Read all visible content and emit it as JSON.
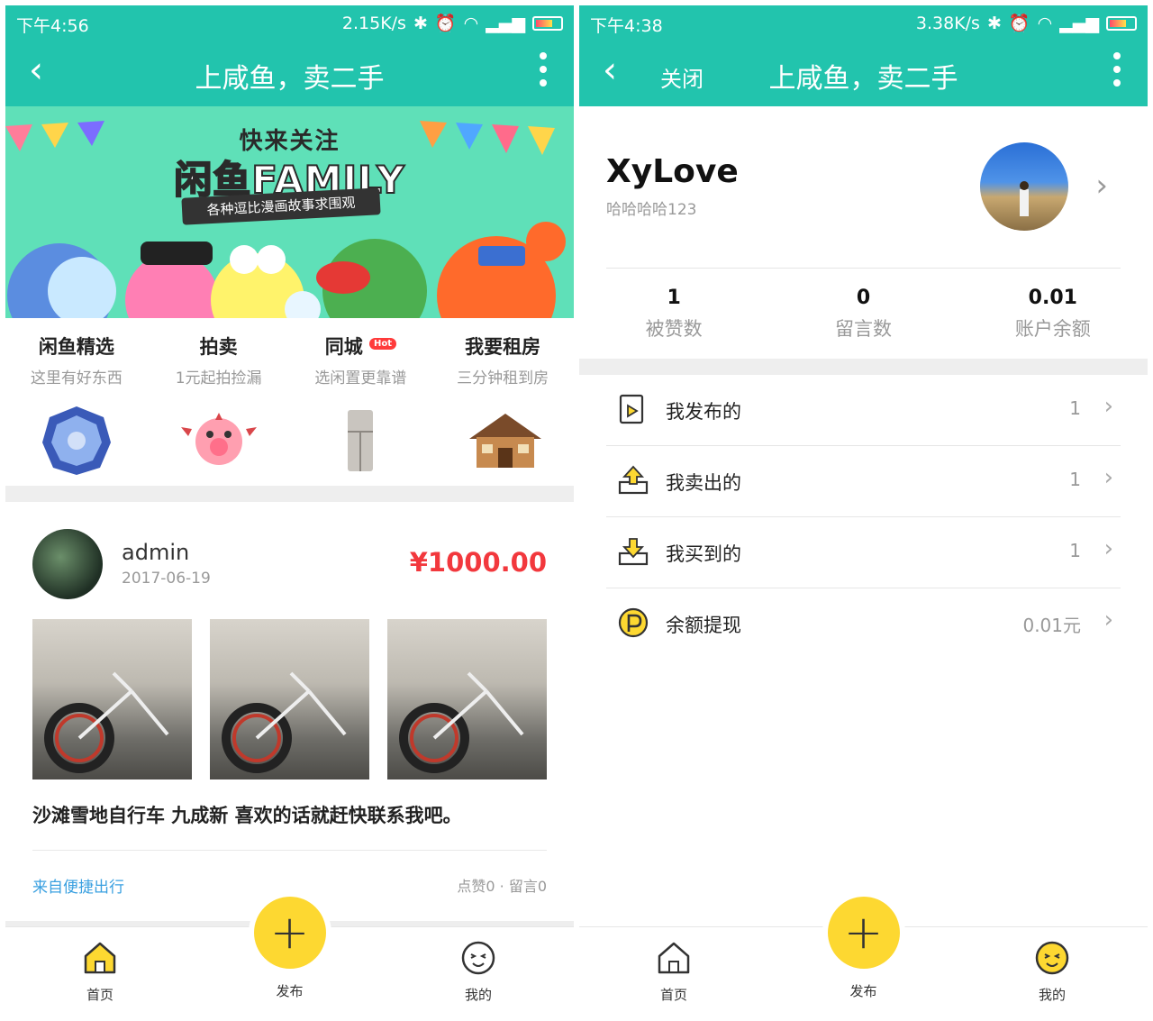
{
  "left": {
    "status": {
      "time": "下午4:56",
      "speed": "2.15K/s"
    },
    "nav": {
      "back": "‹",
      "title": "上咸鱼，卖二手"
    },
    "banner": {
      "line1": "快来关注",
      "line2": "闲鱼FAMILY",
      "line3": "各种逗比漫画故事求围观"
    },
    "categories": [
      {
        "name": "闲鱼精选",
        "sub": "这里有好东西",
        "icon": "umbrella-icon"
      },
      {
        "name": "拍卖",
        "sub": "1元起拍捡漏",
        "icon": "pig-icon"
      },
      {
        "name": "同城",
        "badge": "Hot",
        "sub": "选闲置更靠谱",
        "icon": "fridge-icon"
      },
      {
        "name": "我要租房",
        "sub": "三分钟租到房",
        "icon": "house-icon"
      }
    ],
    "post": {
      "user": "admin",
      "date": "2017-06-19",
      "price": "¥1000.00",
      "description": "沙滩雪地自行车 九成新 喜欢的话就赶快联系我吧。",
      "from": "来自便捷出行",
      "stats": "点赞0 · 留言0"
    },
    "tabbar": {
      "home": "首页",
      "publish": "发布",
      "mine": "我的"
    }
  },
  "right": {
    "status": {
      "time": "下午4:38",
      "speed": "3.38K/s"
    },
    "nav": {
      "back": "‹",
      "close": "关闭",
      "title": "上咸鱼，卖二手"
    },
    "profile": {
      "nickname": "XyLove",
      "account": "哈哈哈哈123"
    },
    "counters": [
      {
        "value": "1",
        "label": "被赞数"
      },
      {
        "value": "0",
        "label": "留言数"
      },
      {
        "value": "0.01",
        "label": "账户余额"
      }
    ],
    "menu": [
      {
        "label": "我发布的",
        "value": "1",
        "icon": "published-icon"
      },
      {
        "label": "我卖出的",
        "value": "1",
        "icon": "sold-icon"
      },
      {
        "label": "我买到的",
        "value": "1",
        "icon": "bought-icon"
      },
      {
        "label": "余额提现",
        "value": "0.01元",
        "icon": "withdraw-icon"
      }
    ],
    "tabbar": {
      "home": "首页",
      "publish": "发布",
      "mine": "我的"
    }
  },
  "colors": {
    "primary": "#22c4ad",
    "price": "#f2383d",
    "fab": "#fdd831",
    "link": "#3aa0e0"
  }
}
